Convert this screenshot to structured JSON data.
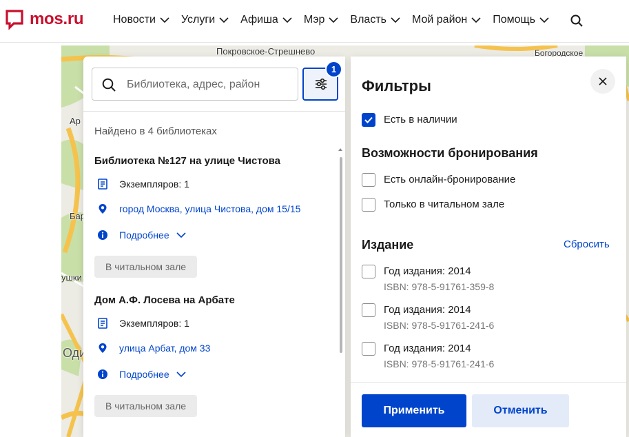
{
  "header": {
    "logo_text": "mos.ru",
    "nav": [
      {
        "label": "Новости"
      },
      {
        "label": "Услуги"
      },
      {
        "label": "Афиша"
      },
      {
        "label": "Мэр"
      },
      {
        "label": "Власть"
      },
      {
        "label": "Мой район"
      },
      {
        "label": "Помощь"
      }
    ]
  },
  "map": {
    "labels": [
      "Покровское-Стрешнево",
      "Богородское",
      "Ар",
      "Бар",
      "ушки",
      "Оди"
    ]
  },
  "search": {
    "placeholder": "Библиотека, адрес, район",
    "filter_badge": "1"
  },
  "results": {
    "found_text": "Найдено в 4 библиотеках",
    "libraries": [
      {
        "title": "Библиотека №127 на улице Чистова",
        "copies": "Экземпляров: 1",
        "address": "город Москва, улица Чистова, дом 15/15",
        "more": "Подробнее",
        "tag": "В читальном зале"
      },
      {
        "title": "Дом А.Ф. Лосева на Арбате",
        "copies": "Экземпляров: 1",
        "address": "улица Арбат, дом 33",
        "more": "Подробнее",
        "tag": "В читальном зале"
      }
    ]
  },
  "filters": {
    "title": "Фильтры",
    "availability": {
      "label": "Есть в наличии",
      "checked": true
    },
    "booking_section": "Возможности бронирования",
    "booking_options": [
      {
        "label": "Есть онлайн-бронирование",
        "checked": false
      },
      {
        "label": "Только в читальном зале",
        "checked": false
      }
    ],
    "edition_section": "Издание",
    "reset_label": "Сбросить",
    "editions": [
      {
        "label": "Год издания: 2014",
        "isbn": "ISBN: 978-5-91761-359-8",
        "checked": false
      },
      {
        "label": "Год издания: 2014",
        "isbn": "ISBN: 978-5-91761-241-6",
        "checked": false
      },
      {
        "label": "Год издания: 2014",
        "isbn": "ISBN: 978-5-91761-241-6",
        "checked": false
      }
    ],
    "apply_label": "Применить",
    "cancel_label": "Отменить"
  },
  "colors": {
    "brand_red": "#c8102e",
    "accent_blue": "#0044cc",
    "map_road_orange": "#f5c34d",
    "map_green": "#c9dfa8"
  },
  "icons": [
    "mos-logo-icon",
    "chevron-down-icon",
    "search-icon",
    "filter-sliders-icon",
    "book-icon",
    "location-pin-icon",
    "info-icon",
    "close-icon",
    "checkmark-icon"
  ]
}
